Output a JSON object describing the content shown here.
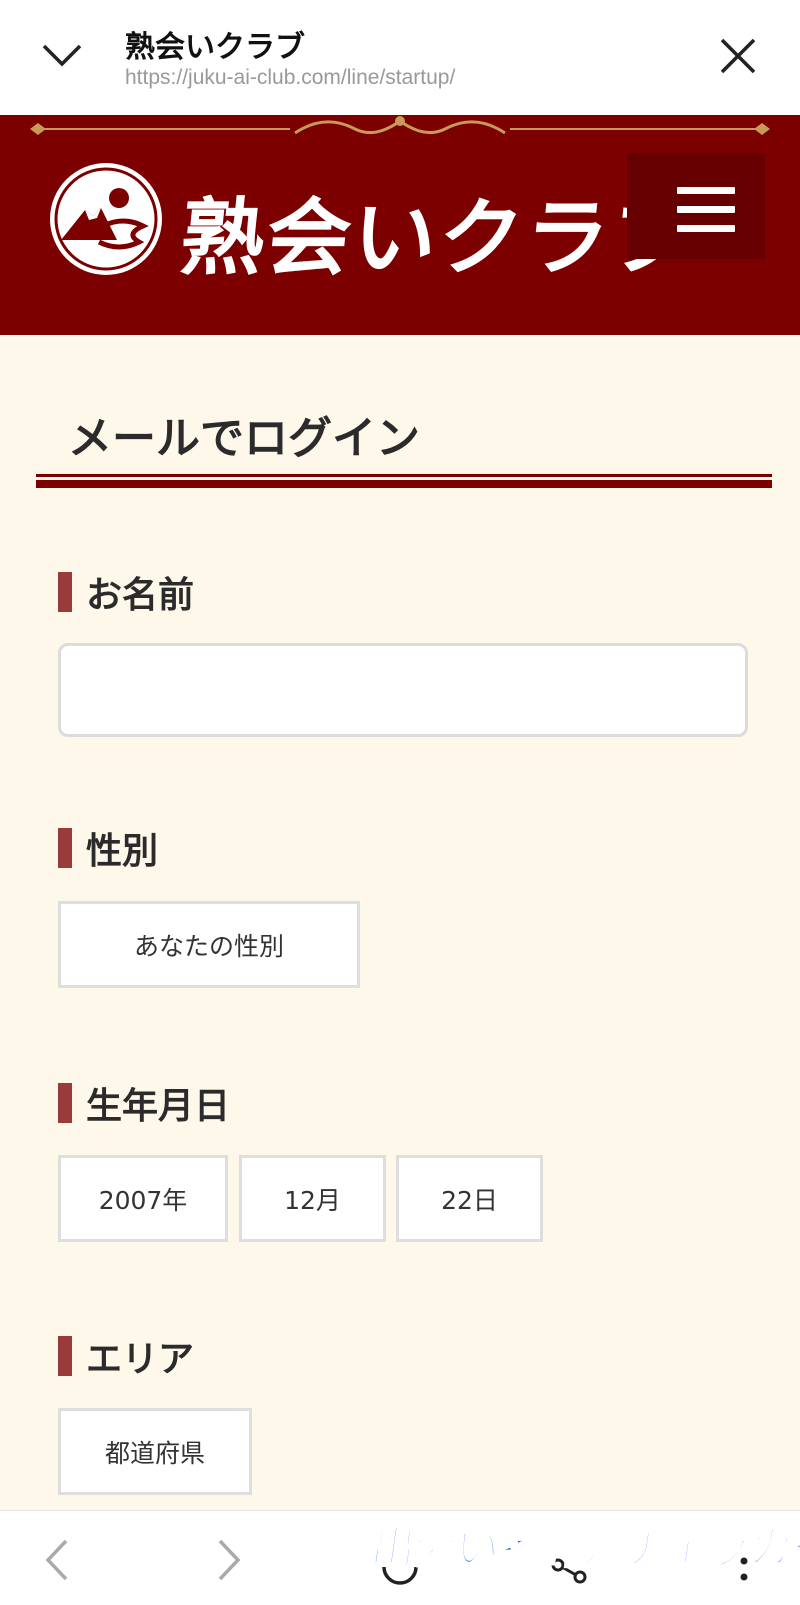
{
  "browser": {
    "title": "熟会いクラブ",
    "url": "https://juku-ai-club.com/line/startup/"
  },
  "site": {
    "logo_text": "熟会いクラブ",
    "brand_color": "#7c0000"
  },
  "form": {
    "page_title": "メールでログイン",
    "name": {
      "label": "お名前",
      "value": ""
    },
    "gender": {
      "label": "性別",
      "selected": "あなたの性別"
    },
    "birthday": {
      "label": "生年月日",
      "year": "2007年",
      "month": "12月",
      "day": "22日"
    },
    "area": {
      "label": "エリア",
      "selected": "都道府県"
    }
  },
  "watermark": "出会い系評判チェッカー",
  "icons": [
    "chevron-down-icon",
    "close-icon",
    "logo-mark-icon",
    "hamburger-icon",
    "back-icon",
    "forward-icon",
    "refresh-icon",
    "share-icon",
    "more-icon"
  ]
}
